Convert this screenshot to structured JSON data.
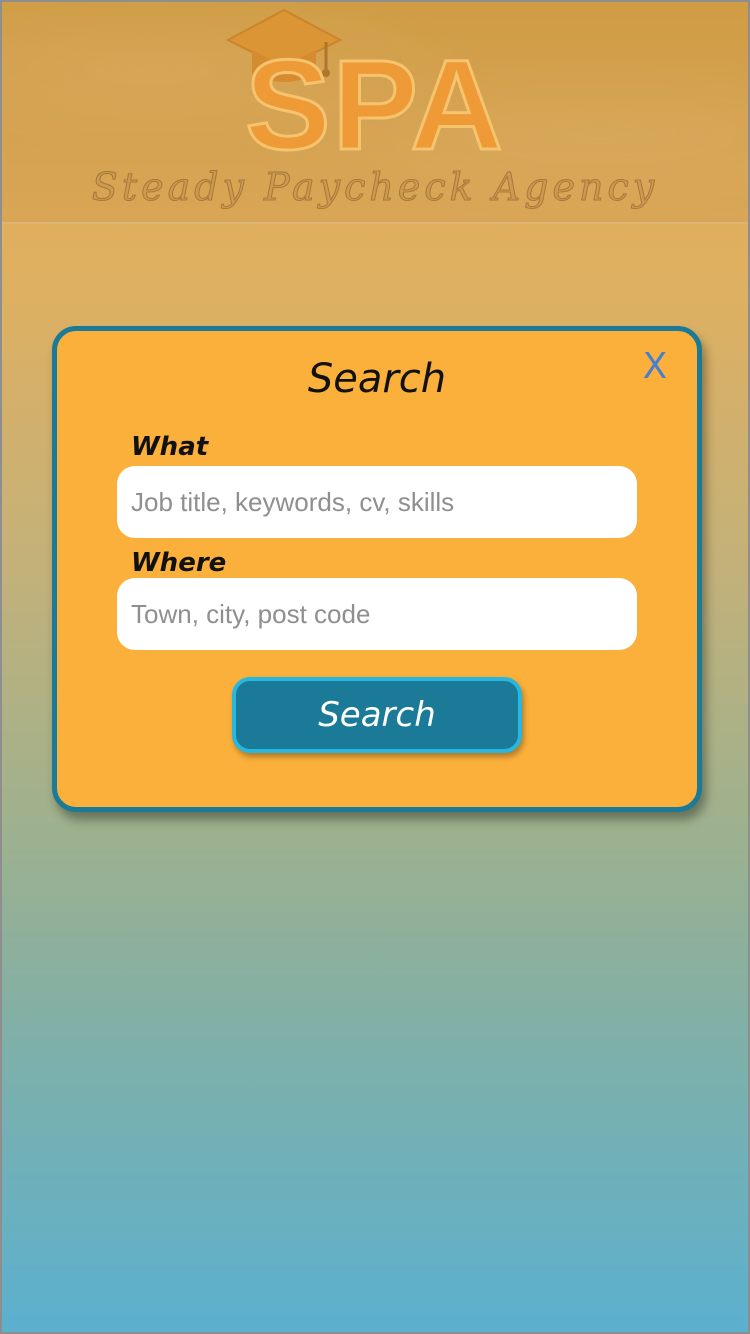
{
  "header": {
    "logo_text": "SPA",
    "logo_subtitle": "Steady Paycheck Agency",
    "icon": "graduation-cap-icon"
  },
  "modal": {
    "title": "Search",
    "close_label": "X",
    "what": {
      "label": "What",
      "placeholder": "Job title, keywords, cv, skills",
      "value": ""
    },
    "where": {
      "label": "Where",
      "placeholder": "Town, city, post code",
      "value": ""
    },
    "search_button_label": "Search"
  },
  "colors": {
    "modal_background": "#fbb03b",
    "modal_border": "#1b7a98",
    "button_background": "#1a7a98",
    "button_border": "#28b7e0",
    "close_color": "#4a7fd0",
    "background_top": "#e4ac52",
    "background_bottom": "#5bb0cf"
  }
}
